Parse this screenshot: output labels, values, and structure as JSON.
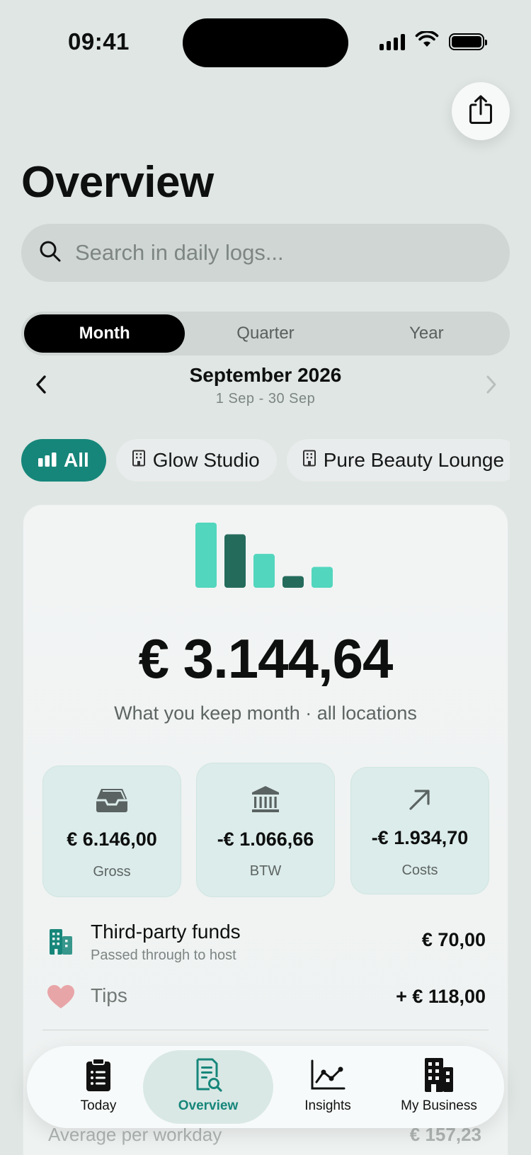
{
  "status_bar": {
    "time": "09:41"
  },
  "header": {
    "title": "Overview"
  },
  "search": {
    "placeholder": "Search in daily logs..."
  },
  "period_tabs": [
    {
      "label": "Month",
      "active": true
    },
    {
      "label": "Quarter",
      "active": false
    },
    {
      "label": "Year",
      "active": false
    }
  ],
  "period": {
    "title": "September 2026",
    "range": "1 Sep - 30 Sep"
  },
  "location_chips": [
    {
      "label": "All",
      "icon": "bar-chart-icon",
      "active": true
    },
    {
      "label": "Glow Studio",
      "icon": "building-icon",
      "active": false
    },
    {
      "label": "Pure Beauty Lounge",
      "icon": "building-icon",
      "active": false
    }
  ],
  "summary": {
    "amount": "€ 3.144,64",
    "subtitle": "What you keep month · all locations",
    "mini_chart": {
      "values": [
        1.0,
        0.82,
        0.52,
        0.18,
        0.32
      ],
      "colors": [
        "#52d6bd",
        "#256b5c",
        "#52d6bd",
        "#256b5c",
        "#52d6bd"
      ]
    }
  },
  "stats": [
    {
      "value": "€ 6.146,00",
      "label": "Gross",
      "icon": "inbox-tray-icon"
    },
    {
      "value": "-€ 1.066,66",
      "label": "BTW",
      "icon": "bank-icon"
    },
    {
      "value": "-€ 1.934,70",
      "label": "Costs",
      "icon": "arrow-up-right-icon"
    }
  ],
  "rows": {
    "third_party": {
      "title": "Third-party funds",
      "subtitle": "Passed through to host",
      "amount": "€ 70,00"
    },
    "tips": {
      "title": "Tips",
      "amount": "+ € 118,00"
    }
  },
  "below_fold": {
    "avg_label": "Average per workday",
    "avg_amount": "€ 157,23"
  },
  "tabbar": [
    {
      "label": "Today",
      "icon": "clipboard-icon",
      "active": false
    },
    {
      "label": "Overview",
      "icon": "document-search-icon",
      "active": true
    },
    {
      "label": "Insights",
      "icon": "line-chart-icon",
      "active": false
    },
    {
      "label": "My Business",
      "icon": "office-building-icon",
      "active": false
    }
  ],
  "colors": {
    "accent": "#16867a",
    "background": "#dfe6e3",
    "teal_light": "#52d6bd",
    "teal_dark": "#256b5c",
    "tips_heart": "#e8a5a8"
  }
}
